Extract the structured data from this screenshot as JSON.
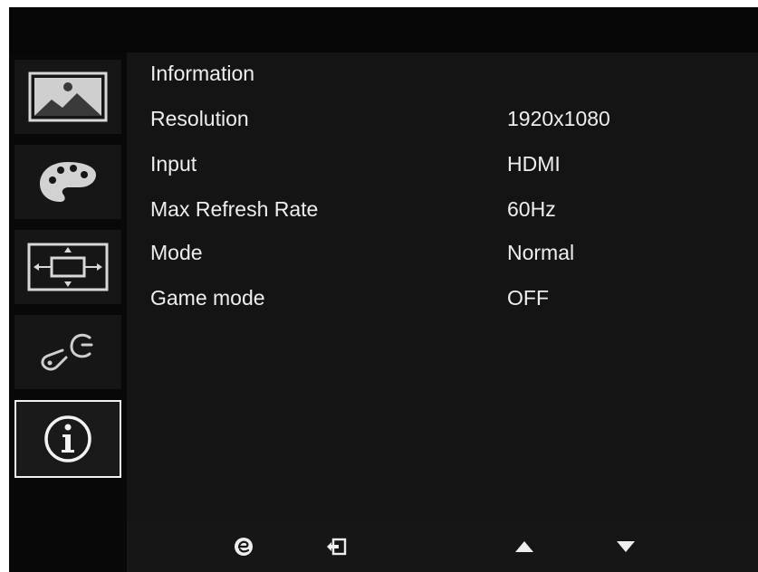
{
  "sidebar": {
    "items": [
      {
        "icon": "picture-icon"
      },
      {
        "icon": "color-palette-icon"
      },
      {
        "icon": "osd-position-icon"
      },
      {
        "icon": "setup-tools-icon"
      },
      {
        "icon": "information-icon",
        "selected": true
      }
    ]
  },
  "panel": {
    "title": "Information",
    "rows": [
      {
        "label": "Resolution",
        "value": "1920x1080"
      },
      {
        "label": "Input",
        "value": "HDMI"
      },
      {
        "label": "Max Refresh Rate",
        "value": "60Hz"
      },
      {
        "label": "Mode",
        "value": "Normal"
      },
      {
        "label": "Game mode",
        "value": "OFF"
      }
    ]
  },
  "bottombar": {
    "buttons": [
      {
        "icon": "empowering-icon"
      },
      {
        "icon": "exit-icon"
      },
      {
        "icon": "arrow-up-icon"
      },
      {
        "icon": "arrow-down-icon"
      }
    ]
  },
  "colors": {
    "background": "#050505",
    "panel": "#141414",
    "text": "#eeeeee",
    "selection_border": "#f2f2f2"
  }
}
